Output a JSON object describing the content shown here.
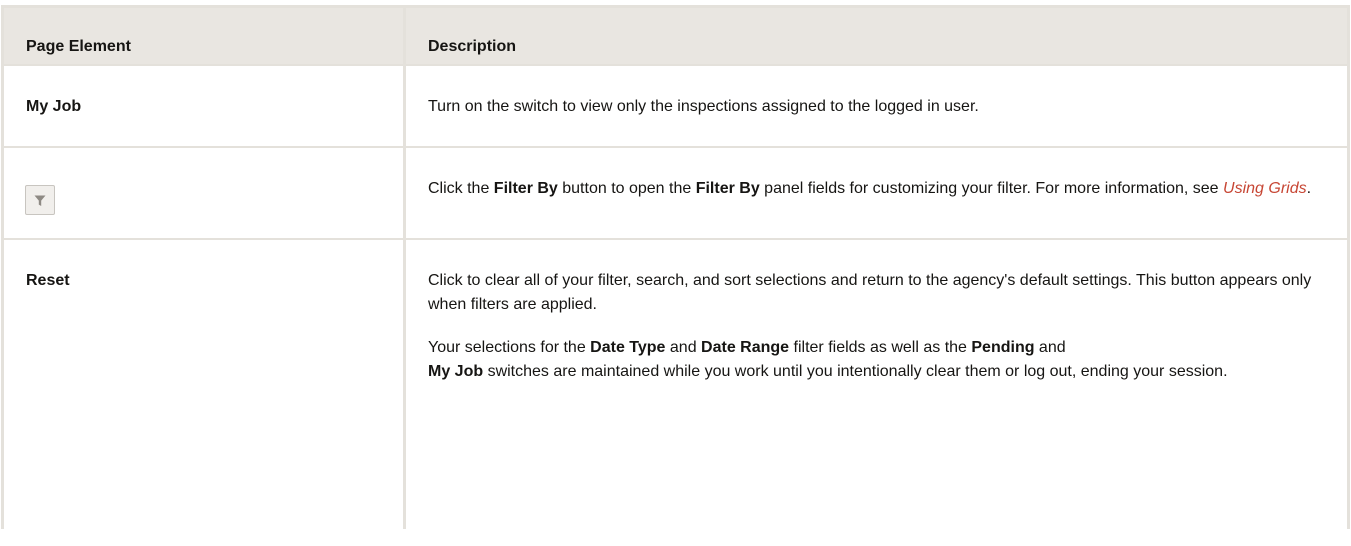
{
  "table": {
    "headers": [
      "Page Element",
      "Description"
    ],
    "rows": {
      "my_job": {
        "element": "My Job",
        "description": "Turn on the switch to view only the inspections assigned to the logged in user."
      },
      "filter_by": {
        "element_icon": "filter-icon",
        "d1": "Click the ",
        "b1": "Filter By",
        "d2": " button to open the ",
        "b2": "Filter By",
        "d3": " panel fields for customizing your filter. For more information, see ",
        "link": "Using Grids",
        "d4": "."
      },
      "reset": {
        "element": "Reset",
        "p1": "Click to clear all of your filter, search, and sort selections and return to the agency's default settings. This button appears only when filters are applied.",
        "p2_a": "Your selections for the ",
        "p2_b1": "Date Type",
        "p2_c": " and ",
        "p2_b2": "Date Range",
        "p2_d": " filter fields as well as the ",
        "p2_b3": "Pending",
        "p2_e": " and ",
        "p2_b4": "My Job",
        "p2_f": " switches are maintained while you work until you intentionally clear them or log out, ending your session."
      }
    }
  },
  "colors": {
    "header_bg": "#e9e6e1",
    "border": "#e4e1db",
    "link": "#c74634",
    "text": "#161513"
  }
}
